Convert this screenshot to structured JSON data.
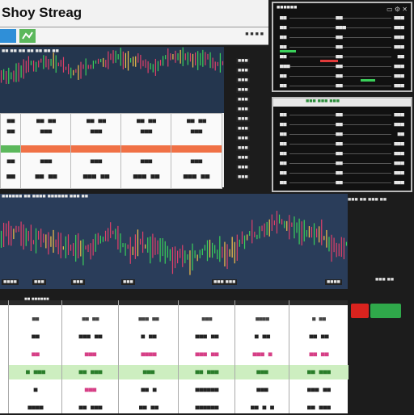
{
  "app": {
    "title": "Shoy Streag"
  },
  "subbar": {
    "right_text": "■ ■ ■ ■"
  },
  "colors": {
    "accent_blue": "#2f8fd8",
    "accent_green": "#5cb85c",
    "up": "#3ad05a",
    "down": "#e23b3b",
    "chart_bg": "#24364e"
  },
  "chart1": {
    "label": "■■ ■■ ■■ ■■ ■■ ■■ ■■",
    "tick_left": "■■"
  },
  "chart2": {
    "label": "■■■■■■ ■■ ■■■■ ■■■■■■ ■■■ ■■",
    "ticks": [
      "■■■■",
      "■■■",
      "■■■",
      "■■■",
      "■■■ ■■■",
      "■■■■"
    ]
  },
  "panel_top": {
    "title": "■■■■■■",
    "rows": [
      {
        "a": "■■",
        "b": "■■",
        "c": "■■■"
      },
      {
        "a": "■■",
        "b": "■■■",
        "c": "■■■"
      },
      {
        "a": "■■",
        "b": "■■",
        "c": "■■■"
      },
      {
        "a": "■■",
        "b": "■■",
        "c": "■■■"
      },
      {
        "a": "■■",
        "b": "■■",
        "c": "■■"
      },
      {
        "a": "■■■",
        "b": "■■",
        "c": "■■■"
      },
      {
        "a": "■■",
        "b": "■■",
        "c": "■■■"
      },
      {
        "a": "■■",
        "b": "■■",
        "c": "■■■"
      }
    ]
  },
  "panel_mid": {
    "title": "■■■ ■■■ ■■■",
    "rows": [
      {
        "a": "■■",
        "b": "■■",
        "c": "■■■"
      },
      {
        "a": "■■",
        "b": "■■",
        "c": "■■■"
      },
      {
        "a": "■■",
        "b": "■■",
        "c": "■■"
      },
      {
        "a": "■■",
        "b": "■■",
        "c": "■■■"
      },
      {
        "a": "■■",
        "b": "■■",
        "c": "■■■"
      },
      {
        "a": "■■",
        "b": "■■",
        "c": "■■■"
      },
      {
        "a": "■■",
        "b": "■■",
        "c": "■■■"
      },
      {
        "a": "■■",
        "b": "■■",
        "c": "■■■"
      }
    ]
  },
  "side_labels": [
    "■■■",
    "■■■",
    "■■■",
    "■■■",
    "■■■",
    "■■■",
    "■■■",
    "■■■",
    "■■■",
    "■■■",
    "■■■",
    "■■■",
    "■■■"
  ],
  "mid_cards": [
    {
      "top": "■■",
      "bottom": "■■",
      "value": "■■"
    },
    {
      "top": "■■ ■■",
      "bottom": "■■■",
      "value": "■■ ■■"
    },
    {
      "top": "■■ ■■",
      "bottom": "■■■",
      "value": "■■■ ■■"
    },
    {
      "top": "■■ ■■",
      "bottom": "■■■",
      "value": "■■■ ■■"
    },
    {
      "top": "■■ ■■",
      "bottom": "■■■",
      "value": "■■■ ■■"
    }
  ],
  "right_mid_header": "■■■ ■■ ■■■ ■■",
  "bottom_legend": "■■■ ■■",
  "bottom_table": {
    "header": "■■ ■■■■■■",
    "columns": [
      {
        "rows": [
          "■■",
          "■■",
          "■■",
          "■ ■■■",
          "■",
          "■■■■"
        ]
      },
      {
        "rows": [
          "■■ ■■",
          "■■■ ■■",
          "■■■",
          "■■ ■■■",
          "■■■",
          "■■ ■■■"
        ]
      },
      {
        "rows": [
          "■■■ ■■",
          "■ ■■",
          "■■■■",
          "■■■",
          "■■ ■",
          "■■ ■■"
        ]
      },
      {
        "rows": [
          "■■■",
          "■■■ ■■",
          "■■■ ■■",
          "■■ ■■■",
          "■■■■■■",
          "■■■■■■"
        ]
      },
      {
        "rows": [
          "■■■■",
          "■ ■■",
          "■■■ ■",
          "■■■",
          "■■■",
          "■■ ■ ■"
        ]
      },
      {
        "rows": [
          "■ ■■",
          "■■ ■■",
          "■■ ■■",
          "■■ ■■■",
          "■■■ ■■",
          "■■ ■■■"
        ]
      },
      {
        "rows": [
          "■■ ■■",
          "■■ ■■",
          "■■ ■■",
          "■■ ■■■",
          "■■■ ■■",
          "■■ ■■"
        ]
      }
    ]
  }
}
